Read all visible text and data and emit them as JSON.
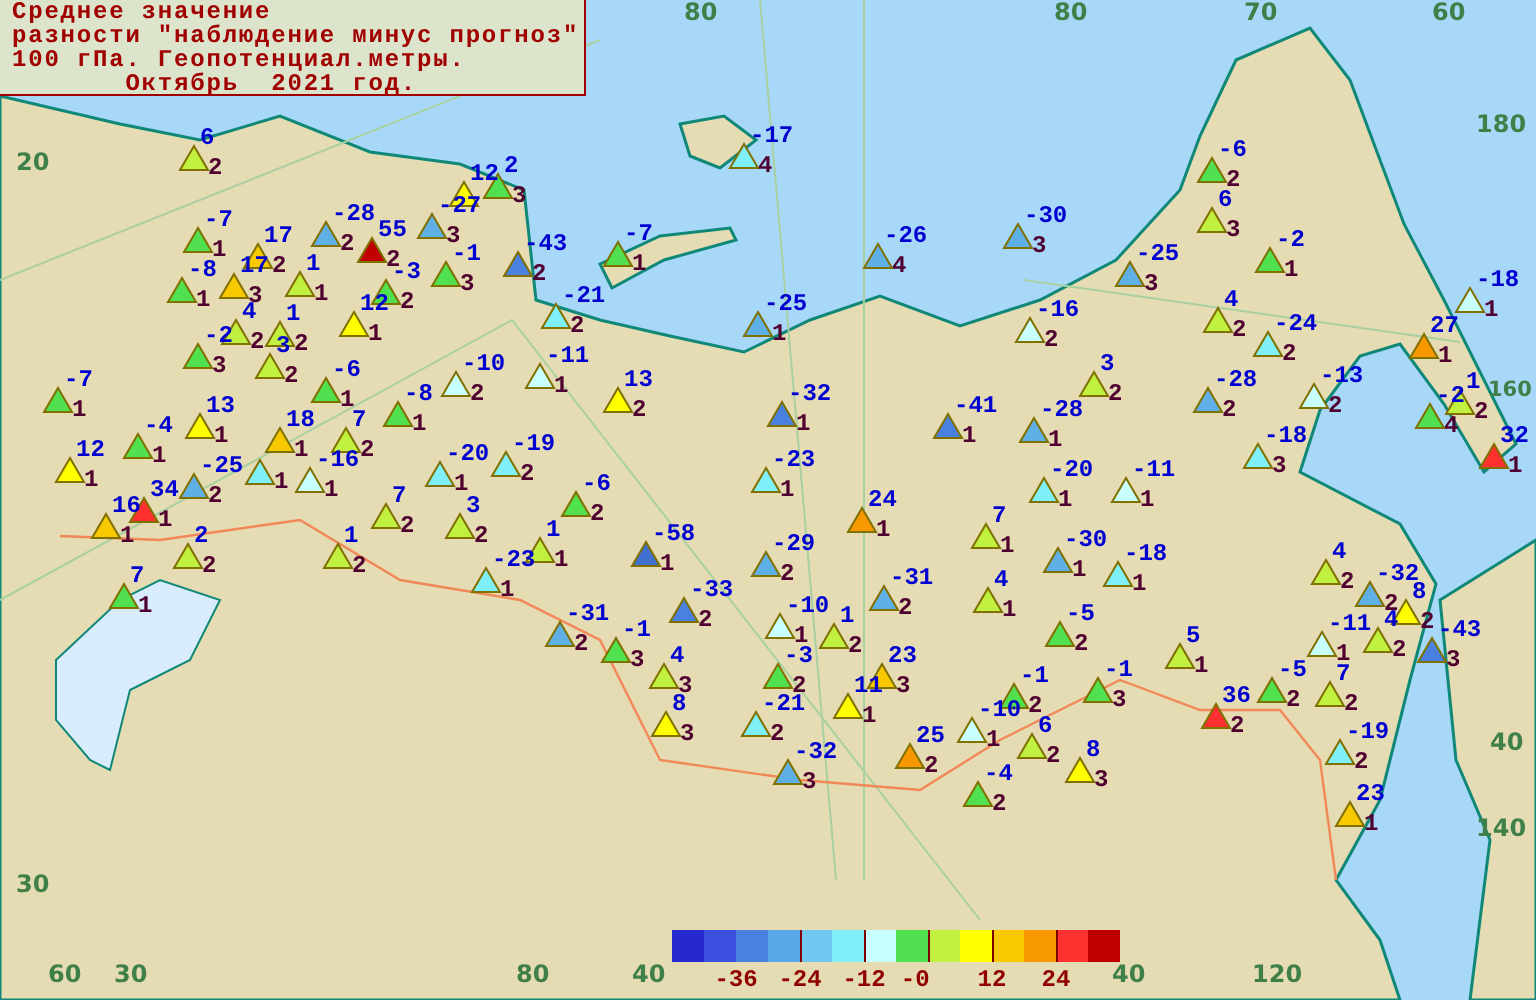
{
  "title_box": {
    "lines": [
      "Среднее значение",
      "разности \"наблюдение минус прогноз\"",
      "100 гПа. Геопотенциал.метры.",
      "       Октябрь  2021 год."
    ]
  },
  "grid_labels": [
    "80",
    "80",
    "70",
    "60",
    "180",
    "20",
    "160",
    "40",
    "140",
    "30",
    "60",
    "30",
    "80",
    "40",
    "40",
    "120"
  ],
  "stations": [
    {
      "value": "6",
      "count": "2",
      "color": "#c0f040"
    },
    {
      "value": "-7",
      "count": "1",
      "color": "#50e050"
    },
    {
      "value": "17",
      "count": "2",
      "color": "#f8c800"
    },
    {
      "value": "-8",
      "count": "1",
      "color": "#50e050"
    },
    {
      "value": "17",
      "count": "3",
      "color": "#f8c800"
    },
    {
      "value": "1",
      "count": "1",
      "color": "#c0f040"
    },
    {
      "value": "-28",
      "count": "2",
      "color": "#60b0e8"
    },
    {
      "value": "55",
      "count": "2",
      "color": "#c00000"
    },
    {
      "value": "12",
      "color": "#ffff00"
    },
    {
      "value": "2",
      "count": "3",
      "color": "#50e050"
    },
    {
      "value": "-27",
      "count": "3",
      "color": "#60b0e8"
    },
    {
      "value": "-1",
      "count": "3",
      "color": "#50e050"
    },
    {
      "value": "-3",
      "count": "2",
      "color": "#50e050"
    },
    {
      "value": "4",
      "count": "2",
      "color": "#c0f040"
    },
    {
      "value": "1",
      "count": "2",
      "color": "#c0f040"
    },
    {
      "value": "12",
      "count": "1",
      "color": "#ffff00"
    },
    {
      "value": "-2",
      "count": "3",
      "color": "#50e050"
    },
    {
      "value": "3",
      "count": "2",
      "color": "#c0f040"
    },
    {
      "value": "-6",
      "count": "1",
      "color": "#50e050"
    },
    {
      "value": "-10",
      "count": "2",
      "color": "#c8ffff"
    },
    {
      "value": "-8",
      "count": "1",
      "color": "#50e050"
    },
    {
      "value": "-7",
      "count": "1",
      "color": "#50e050"
    },
    {
      "value": "13",
      "count": "1",
      "color": "#ffff00"
    },
    {
      "value": "-4",
      "count": "1",
      "color": "#50e050"
    },
    {
      "value": "18",
      "count": "1",
      "color": "#f8c800"
    },
    {
      "value": "7",
      "count": "2",
      "color": "#c0f040"
    },
    {
      "value": "12",
      "count": "1",
      "color": "#ffff00"
    },
    {
      "value": "-25",
      "count": "2",
      "color": "#60b0e8"
    },
    {
      "count": "1",
      "color": "#80f0f8"
    },
    {
      "value": "-16",
      "count": "1",
      "color": "#c8ffff"
    },
    {
      "value": "-20",
      "count": "1",
      "color": "#80f0f8"
    },
    {
      "value": "34",
      "count": "1",
      "color": "#ff3030"
    },
    {
      "value": "16",
      "count": "1",
      "color": "#f8c800"
    },
    {
      "value": "2",
      "count": "2",
      "color": "#c0f040"
    },
    {
      "value": "7",
      "count": "1",
      "color": "#50e050"
    },
    {
      "value": "7",
      "count": "2",
      "color": "#c0f040"
    },
    {
      "value": "3",
      "count": "2",
      "color": "#c0f040"
    },
    {
      "value": "1",
      "count": "2",
      "color": "#c0f040"
    },
    {
      "value": "-23",
      "count": "1",
      "color": "#80f0f8"
    },
    {
      "value": "-17",
      "count": "4",
      "color": "#80f0f8"
    },
    {
      "value": "-43",
      "count": "2",
      "color": "#4a80e0"
    },
    {
      "value": "-7",
      "count": "1",
      "color": "#50e050"
    },
    {
      "value": "-21",
      "count": "2",
      "color": "#80f0f8"
    },
    {
      "value": "-11",
      "count": "1",
      "color": "#c8ffff"
    },
    {
      "value": "13",
      "count": "2",
      "color": "#ffff00"
    },
    {
      "value": "-19",
      "count": "2",
      "color": "#80f0f8"
    },
    {
      "value": "-6",
      "count": "2",
      "color": "#50e050"
    },
    {
      "value": "-25",
      "count": "1",
      "color": "#60b0e8"
    },
    {
      "value": "-26",
      "count": "4",
      "color": "#60b0e8"
    },
    {
      "value": "-32",
      "count": "1",
      "color": "#4a80e0"
    },
    {
      "value": "-41",
      "count": "1",
      "color": "#4a80e0"
    },
    {
      "value": "-23",
      "count": "1",
      "color": "#80f0f8"
    },
    {
      "value": "-30",
      "count": "3",
      "color": "#60b0e8"
    },
    {
      "value": "24",
      "count": "1",
      "color": "#f89800"
    },
    {
      "value": "-6",
      "count": "2",
      "color": "#50e050"
    },
    {
      "value": "6",
      "count": "3",
      "color": "#c0f040"
    },
    {
      "value": "-25",
      "count": "3",
      "color": "#60b0e8"
    },
    {
      "value": "-2",
      "count": "1",
      "color": "#50e050"
    },
    {
      "value": "-16",
      "count": "2",
      "color": "#c8ffff"
    },
    {
      "value": "4",
      "count": "2",
      "color": "#c0f040"
    },
    {
      "value": "-24",
      "count": "2",
      "color": "#80f0f8"
    },
    {
      "value": "3",
      "count": "2",
      "color": "#c0f040"
    },
    {
      "value": "-28",
      "count": "2",
      "color": "#60b0e8"
    },
    {
      "value": "-13",
      "count": "2",
      "color": "#c8ffff"
    },
    {
      "value": "-28",
      "count": "1",
      "color": "#60b0e8"
    },
    {
      "value": "-18",
      "count": "3",
      "color": "#80f0f8"
    },
    {
      "value": "-20",
      "count": "1",
      "color": "#80f0f8"
    },
    {
      "value": "-11",
      "count": "1",
      "color": "#c8ffff"
    },
    {
      "value": "-18",
      "count": "1",
      "color": "#c8ffff"
    },
    {
      "value": "27",
      "count": "1",
      "color": "#f89800"
    },
    {
      "value": "-2",
      "count": "4",
      "color": "#50e050"
    },
    {
      "value": "1",
      "count": "2",
      "color": "#c0f040"
    },
    {
      "value": "32",
      "count": "1",
      "color": "#ff3030"
    },
    {
      "value": "1",
      "count": "1",
      "color": "#c0f040"
    },
    {
      "value": "-58",
      "count": "1",
      "color": "#4070d0"
    },
    {
      "value": "-29",
      "count": "2",
      "color": "#60b0e8"
    },
    {
      "value": "7",
      "count": "1",
      "color": "#c0f040"
    },
    {
      "value": "-31",
      "count": "2",
      "color": "#60b0e8"
    },
    {
      "value": "-1",
      "count": "3",
      "color": "#50e050"
    },
    {
      "value": "-33",
      "count": "2",
      "color": "#4a80e0"
    },
    {
      "value": "-10",
      "count": "1",
      "color": "#c8ffff"
    },
    {
      "value": "1",
      "count": "2",
      "color": "#c0f040"
    },
    {
      "value": "-31",
      "count": "2",
      "color": "#60b0e8"
    },
    {
      "value": "4",
      "count": "1",
      "color": "#c0f040"
    },
    {
      "value": "4",
      "count": "3",
      "color": "#c0f040"
    },
    {
      "value": "8",
      "count": "3",
      "color": "#ffff00"
    },
    {
      "value": "-3",
      "count": "2",
      "color": "#50e050"
    },
    {
      "value": "-21",
      "count": "2",
      "color": "#80f0f8"
    },
    {
      "value": "11",
      "count": "1",
      "color": "#ffff00"
    },
    {
      "value": "23",
      "count": "3",
      "color": "#f8c800"
    },
    {
      "value": "-10",
      "count": "1",
      "color": "#c8ffff"
    },
    {
      "value": "-32",
      "count": "3",
      "color": "#60b0e8"
    },
    {
      "value": "25",
      "count": "2",
      "color": "#f89800"
    },
    {
      "value": "-4",
      "count": "2",
      "color": "#50e050"
    },
    {
      "value": "-1",
      "count": "2",
      "color": "#50e050"
    },
    {
      "value": "-30",
      "count": "1",
      "color": "#60b0e8"
    },
    {
      "value": "-18",
      "count": "1",
      "color": "#80f0f8"
    },
    {
      "value": "-5",
      "count": "2",
      "color": "#50e050"
    },
    {
      "value": "5",
      "count": "1",
      "color": "#c0f040"
    },
    {
      "value": "-1",
      "count": "3",
      "color": "#50e050"
    },
    {
      "value": "6",
      "count": "2",
      "color": "#c0f040"
    },
    {
      "value": "8",
      "count": "3",
      "color": "#ffff00"
    },
    {
      "value": "36",
      "count": "2",
      "color": "#ff3030"
    },
    {
      "value": "-5",
      "count": "2",
      "color": "#50e050"
    },
    {
      "value": "4",
      "count": "2",
      "color": "#c0f040"
    },
    {
      "value": "-32",
      "count": "2",
      "color": "#60b0e8"
    },
    {
      "value": "8",
      "count": "2",
      "color": "#ffff00"
    },
    {
      "value": "-11",
      "count": "1",
      "color": "#c8ffff"
    },
    {
      "value": "4",
      "count": "2",
      "color": "#c0f040"
    },
    {
      "value": "-43",
      "count": "3",
      "color": "#4a80e0"
    },
    {
      "value": "7",
      "count": "2",
      "color": "#c0f040"
    },
    {
      "value": "-19",
      "count": "2",
      "color": "#80f0f8"
    },
    {
      "value": "23",
      "count": "1",
      "color": "#f8c800"
    }
  ],
  "legend": {
    "items": [
      {
        "color": "#2828d0"
      },
      {
        "color": "#3c50e0"
      },
      {
        "color": "#4a80e0"
      },
      {
        "color": "#58a8e8"
      },
      {
        "color": "#70c8f0"
      },
      {
        "color": "#80f0f8"
      },
      {
        "color": "#c8ffff"
      },
      {
        "color": "#50e050"
      },
      {
        "color": "#c0f040"
      },
      {
        "color": "#ffff00"
      },
      {
        "color": "#f8c800"
      },
      {
        "color": "#f89800"
      },
      {
        "color": "#ff3030"
      },
      {
        "color": "#c00000"
      }
    ],
    "labels": [
      "-36",
      "-24",
      "-12",
      "-0",
      "12",
      "24"
    ]
  }
}
